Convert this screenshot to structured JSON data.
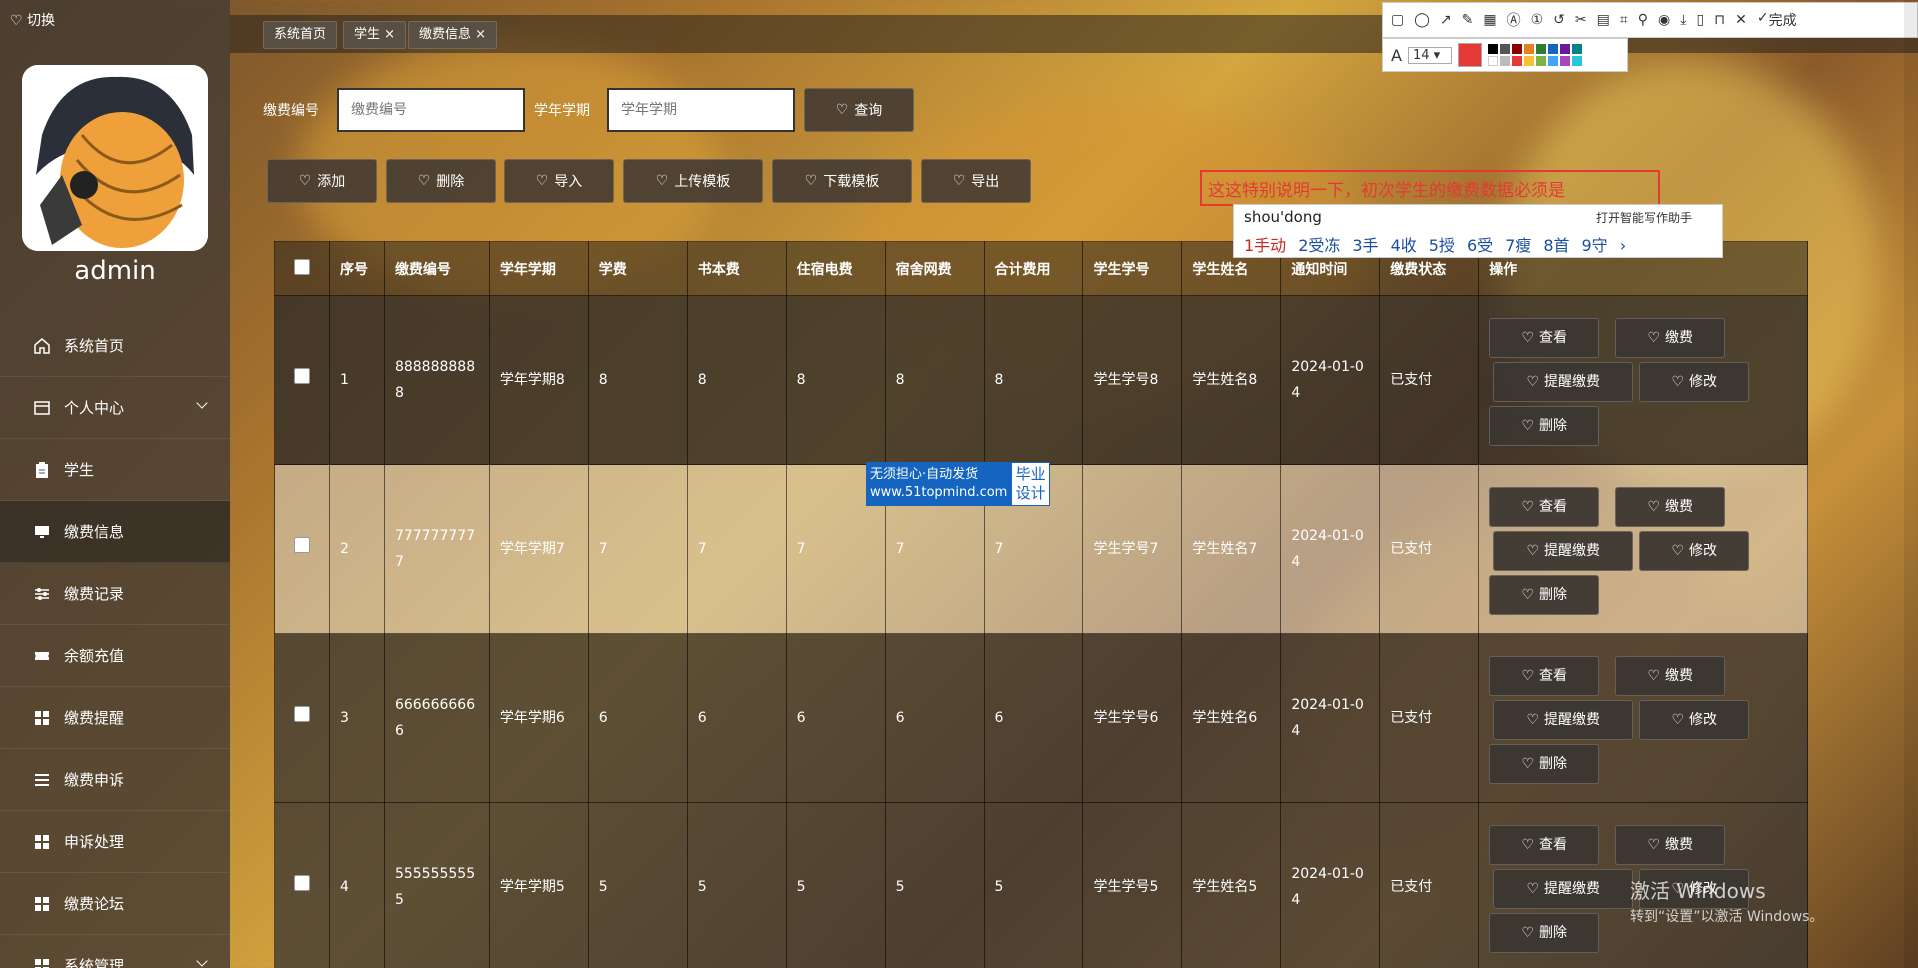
{
  "sidebar": {
    "switch_label": "切换",
    "username": "admin",
    "menu": [
      {
        "label": "系统首页",
        "icon": "home-icon"
      },
      {
        "label": "个人中心",
        "icon": "card-icon",
        "expand": true
      },
      {
        "label": "学生",
        "icon": "clipboard-icon"
      },
      {
        "label": "缴费信息",
        "icon": "monitor-icon",
        "active": true
      },
      {
        "label": "缴费记录",
        "icon": "sliders-icon"
      },
      {
        "label": "余额充值",
        "icon": "ticket-icon"
      },
      {
        "label": "缴费提醒",
        "icon": "grid-icon"
      },
      {
        "label": "缴费申诉",
        "icon": "list-icon"
      },
      {
        "label": "申诉处理",
        "icon": "grid-icon"
      },
      {
        "label": "缴费论坛",
        "icon": "grid-icon"
      },
      {
        "label": "系统管理",
        "icon": "grid-icon",
        "expand": true
      }
    ]
  },
  "tabs": [
    {
      "label": "系统首页"
    },
    {
      "label": "学生 ×"
    },
    {
      "label": "缴费信息 ×"
    }
  ],
  "search": {
    "code_label": "缴费编号",
    "code_placeholder": "缴费编号",
    "term_label": "学年学期",
    "term_placeholder": "学年学期",
    "query_label": "查询"
  },
  "actions": {
    "add": "添加",
    "delete": "删除",
    "import": "导入",
    "upload_template": "上传模板",
    "download_template": "下载模板",
    "export": "导出"
  },
  "table": {
    "headers": [
      "序号",
      "缴费编号",
      "学年学期",
      "学费",
      "书本费",
      "住宿电费",
      "宿舍网费",
      "合计费用",
      "学生学号",
      "学生姓名",
      "通知时间",
      "缴费状态",
      "操作"
    ],
    "rows": [
      {
        "seq": "1",
        "code": "8888888888",
        "term": "学年学期8",
        "tuition": "8",
        "book": "8",
        "elec": "8",
        "net": "8",
        "total": "8",
        "sno": "学生学号8",
        "sname": "学生姓名8",
        "time": "2024-01-04",
        "status": "已支付"
      },
      {
        "seq": "2",
        "code": "7777777777",
        "term": "学年学期7",
        "tuition": "7",
        "book": "7",
        "elec": "7",
        "net": "7",
        "total": "7",
        "sno": "学生学号7",
        "sname": "学生姓名7",
        "time": "2024-01-04",
        "status": "已支付"
      },
      {
        "seq": "3",
        "code": "6666666666",
        "term": "学年学期6",
        "tuition": "6",
        "book": "6",
        "elec": "6",
        "net": "6",
        "total": "6",
        "sno": "学生学号6",
        "sname": "学生姓名6",
        "time": "2024-01-04",
        "status": "已支付"
      },
      {
        "seq": "4",
        "code": "5555555555",
        "term": "学年学期5",
        "tuition": "5",
        "book": "5",
        "elec": "5",
        "net": "5",
        "total": "5",
        "sno": "学生学号5",
        "sname": "学生姓名5",
        "time": "2024-01-04",
        "status": "已支付"
      }
    ],
    "ops": {
      "view": "查看",
      "pay": "缴费",
      "remind": "提醒缴费",
      "edit": "修改",
      "delete": "删除"
    }
  },
  "overlay": {
    "annotation": "这这特别说明一下，初次学生的缴费数据必须是",
    "font_size": "14",
    "done_label": "完成",
    "ime_pinyin": "shou'dong",
    "ime_helper": "打开智能写作助手",
    "ime_candidates": [
      "1手动",
      "2受冻",
      "3手",
      "4收",
      "5授",
      "6受",
      "7瘦",
      "8首",
      "9守"
    ],
    "watermark_left1": "无须担心·自动发货",
    "watermark_left2": "www.51topmind.com",
    "watermark_right": "毕业设计",
    "windows_line1": "激活 Windows",
    "windows_line2": "转到“设置”以激活 Windows。"
  },
  "colors": {
    "accent": "#e53935",
    "ime_blue": "#1a4fa0",
    "watermark_blue": "#1565c0"
  }
}
